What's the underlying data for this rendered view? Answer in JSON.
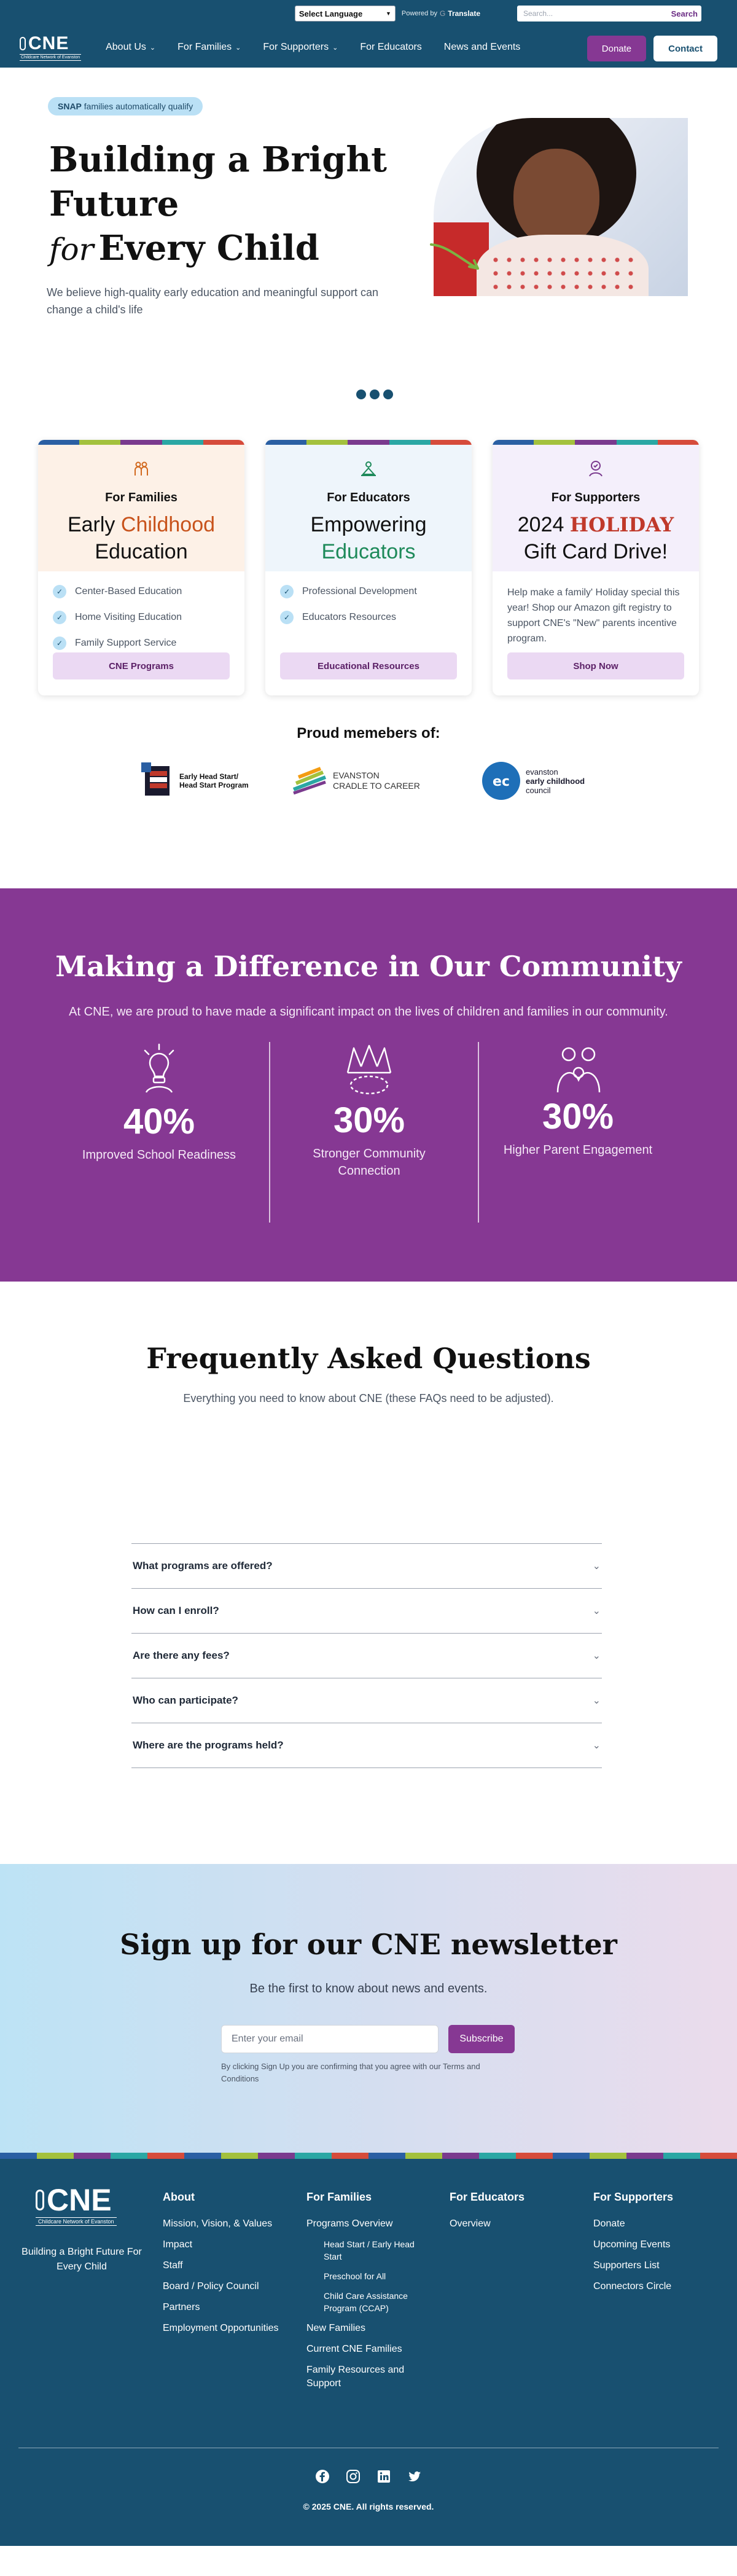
{
  "utility": {
    "language_label": "Select Language",
    "powered_by": "Powered by",
    "translate": "Translate",
    "search_placeholder": "Search...",
    "search_button": "Search"
  },
  "brand": {
    "logo_text": "CNE",
    "logo_subtitle": "Childcare Network of Evanston"
  },
  "nav": {
    "items": [
      {
        "label": "About Us",
        "dropdown": true
      },
      {
        "label": "For Families",
        "dropdown": true
      },
      {
        "label": "For Supporters",
        "dropdown": true
      },
      {
        "label": "For Educators",
        "dropdown": false
      },
      {
        "label": "News and Events",
        "dropdown": false
      }
    ],
    "donate": "Donate",
    "contact": "Contact"
  },
  "hero": {
    "badge_bold": "SNAP",
    "badge_rest": "families automatically qualify",
    "title_line1": "Building a Bright",
    "title_line2": "Future",
    "title_for": "for",
    "title_line3": "Every Child",
    "subtitle": "We believe high-quality early education and meaningful support can change a child's life"
  },
  "colors": {
    "primary": "#185070",
    "accent": "#863893",
    "stripe": [
      "#2a5fa3",
      "#a3c13d",
      "#7a3a8e",
      "#2aa7a4",
      "#d64b3b"
    ]
  },
  "cards": [
    {
      "tag": "For Families",
      "title_pre": "Early ",
      "title_hl": "Childhood",
      "title_post": "Education",
      "highlight_color": "#c8531c",
      "items": [
        "Center-Based Education",
        "Home Visiting Education",
        "Family Support Service"
      ],
      "button": "CNE Programs"
    },
    {
      "tag": "For Educators",
      "title_pre": "Empowering",
      "title_hl": "Educators",
      "title_post": "",
      "highlight_color": "#1e8a5a",
      "items": [
        "Professional Development",
        "Educators Resources"
      ],
      "button": "Educational Resources"
    },
    {
      "tag": "For Supporters",
      "title_pre": "2024 ",
      "title_hl": "HOLIDAY",
      "title_post": "Gift Card Drive!",
      "highlight_color": "#c0392b",
      "paragraph": "Help make a family' Holiday special this year! Shop our Amazon gift registry to support CNE's \"New\" parents incentive program.",
      "button": "Shop Now"
    }
  ],
  "members": {
    "heading": "Proud memebers of:",
    "logos": [
      {
        "line1": "Early Head Start/",
        "line2": "Head Start Program"
      },
      {
        "line1": "EVANSTON",
        "line2": "CRADLE TO CAREER"
      },
      {
        "line1": "evanston",
        "line2": "early childhood",
        "line3": "council"
      }
    ]
  },
  "impact": {
    "heading": "Making a Difference in Our Community",
    "lead": "At CNE, we are proud to have made a significant impact on the lives of children and families in our community.",
    "stats": [
      {
        "value": "40%",
        "label": "Improved School Readiness"
      },
      {
        "value": "30%",
        "label": "Stronger Community Connection"
      },
      {
        "value": "30%",
        "label": "Higher Parent Engagement"
      }
    ]
  },
  "faq": {
    "heading": "Frequently Asked Questions",
    "subtitle": "Everything you need to know about CNE (these FAQs need to be adjusted).",
    "items": [
      "What programs are offered?",
      "How can I enroll?",
      "Are there any fees?",
      "Who can participate?",
      "Where are the programs held?"
    ]
  },
  "newsletter": {
    "heading": "Sign up for our CNE newsletter",
    "subtitle": "Be the first to know about news and events.",
    "placeholder": "Enter your email",
    "button": "Subscribe",
    "terms": "By clicking Sign Up you are confirming that you agree with our Terms and Conditions"
  },
  "footer": {
    "tagline": "Building a Bright Future For Every Child",
    "columns": [
      {
        "heading": "About",
        "links": [
          "Mission, Vision, & Values",
          "Impact",
          "Staff",
          "Board / Policy Council",
          "Partners",
          "Employment Opportunities"
        ]
      },
      {
        "heading": "For Families",
        "links": [
          "Programs Overview"
        ],
        "sub_links": [
          "Head Start / Early Head Start",
          "Preschool for All",
          "Child Care Assistance Program (CCAP)"
        ],
        "links_after": [
          "New Families",
          "Current CNE Families",
          "Family Resources and Support"
        ]
      },
      {
        "heading": "For Educators",
        "links": [
          "Overview"
        ]
      },
      {
        "heading": "For Supporters",
        "links": [
          "Donate",
          "Upcoming Events",
          "Supporters List",
          "Connectors Circle"
        ]
      }
    ],
    "social": [
      "facebook-icon",
      "instagram-icon",
      "linkedin-icon",
      "twitter-icon"
    ],
    "copyright": "© 2025 CNE. All rights reserved."
  }
}
